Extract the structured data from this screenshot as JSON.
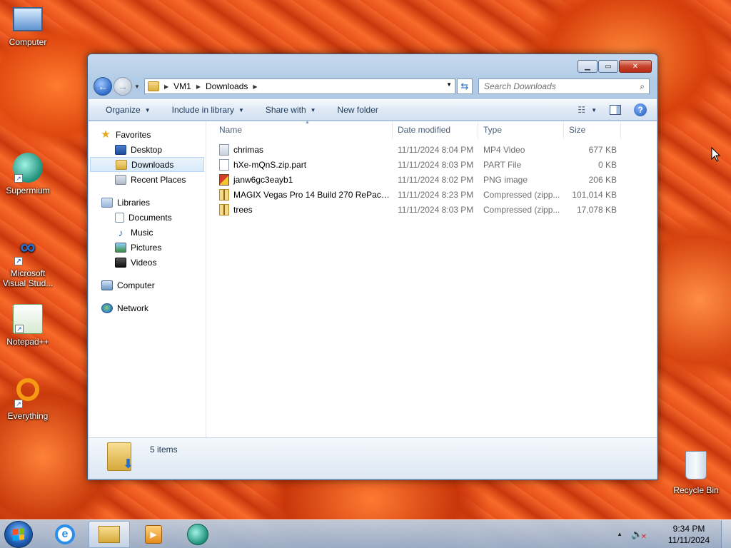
{
  "desktop": {
    "icons": [
      {
        "label": "Computer"
      },
      {
        "label": "Supermium"
      },
      {
        "label": "Microsoft Visual Stud..."
      },
      {
        "label": "Notepad++"
      },
      {
        "label": "Everything"
      },
      {
        "label": "Recycle Bin"
      }
    ]
  },
  "window": {
    "breadcrumb": [
      "VM1",
      "Downloads"
    ],
    "search_placeholder": "Search Downloads",
    "toolbar": {
      "organize": "Organize",
      "include_in_library": "Include in library",
      "share_with": "Share with",
      "new_folder": "New folder"
    },
    "nav": {
      "favorites": "Favorites",
      "desktop": "Desktop",
      "downloads": "Downloads",
      "recent_places": "Recent Places",
      "libraries": "Libraries",
      "documents": "Documents",
      "music": "Music",
      "pictures": "Pictures",
      "videos": "Videos",
      "computer": "Computer",
      "network": "Network"
    },
    "columns": {
      "name": "Name",
      "date_modified": "Date modified",
      "type": "Type",
      "size": "Size"
    },
    "files": [
      {
        "name": "chrimas",
        "date": "11/11/2024 8:04 PM",
        "type": "MP4 Video",
        "size": "677 KB",
        "icon": "video-file-icon"
      },
      {
        "name": "hXe-mQnS.zip.part",
        "date": "11/11/2024 8:03 PM",
        "type": "PART File",
        "size": "0 KB",
        "icon": "blank-file-icon"
      },
      {
        "name": "janw6gc3eayb1",
        "date": "11/11/2024 8:02 PM",
        "type": "PNG image",
        "size": "206 KB",
        "icon": "image-file-icon"
      },
      {
        "name": "MAGIX Vegas Pro 14 Build 270 RePack by...",
        "date": "11/11/2024 8:23 PM",
        "type": "Compressed (zipp...",
        "size": "101,014 KB",
        "icon": "zip-folder-icon"
      },
      {
        "name": "trees",
        "date": "11/11/2024 8:03 PM",
        "type": "Compressed (zipp...",
        "size": "17,078 KB",
        "icon": "zip-folder-icon"
      }
    ],
    "details": {
      "item_count": "5 items"
    }
  },
  "taskbar": {
    "time": "9:34 PM",
    "date": "11/11/2024"
  }
}
